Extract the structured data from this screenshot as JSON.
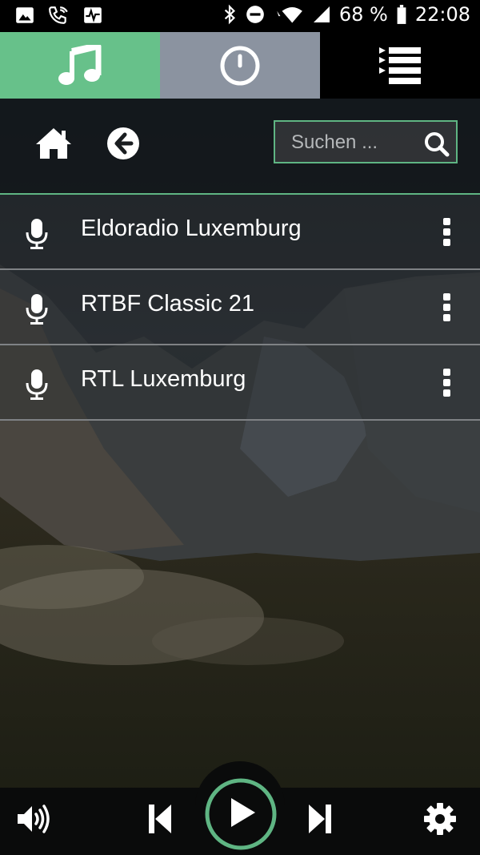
{
  "status_bar": {
    "battery_percent": "68 %",
    "time": "22:08",
    "icons_left": [
      "gallery-icon",
      "phone-wifi-icon",
      "activity-icon"
    ],
    "icons_right": [
      "bluetooth-icon",
      "do-not-disturb-icon",
      "wifi-icon",
      "signal-icon",
      "battery-icon"
    ]
  },
  "tabs": [
    {
      "icon": "music-note-icon",
      "active": true,
      "color": "#67c18a"
    },
    {
      "icon": "timer-icon",
      "active": false,
      "color": "#8b93a0"
    },
    {
      "icon": "queue-list-icon",
      "active": false,
      "color": "#000000"
    }
  ],
  "toolbar": {
    "search_placeholder": "Suchen ...",
    "accent": "#5fb583"
  },
  "stations": [
    {
      "label": "Eldoradio Luxemburg"
    },
    {
      "label": "RTBF Classic 21"
    },
    {
      "label": "RTL Luxemburg"
    }
  ],
  "player": {
    "controls": [
      "volume-icon",
      "previous-icon",
      "play-icon",
      "next-icon",
      "settings-icon"
    ],
    "accent": "#5fb583"
  }
}
